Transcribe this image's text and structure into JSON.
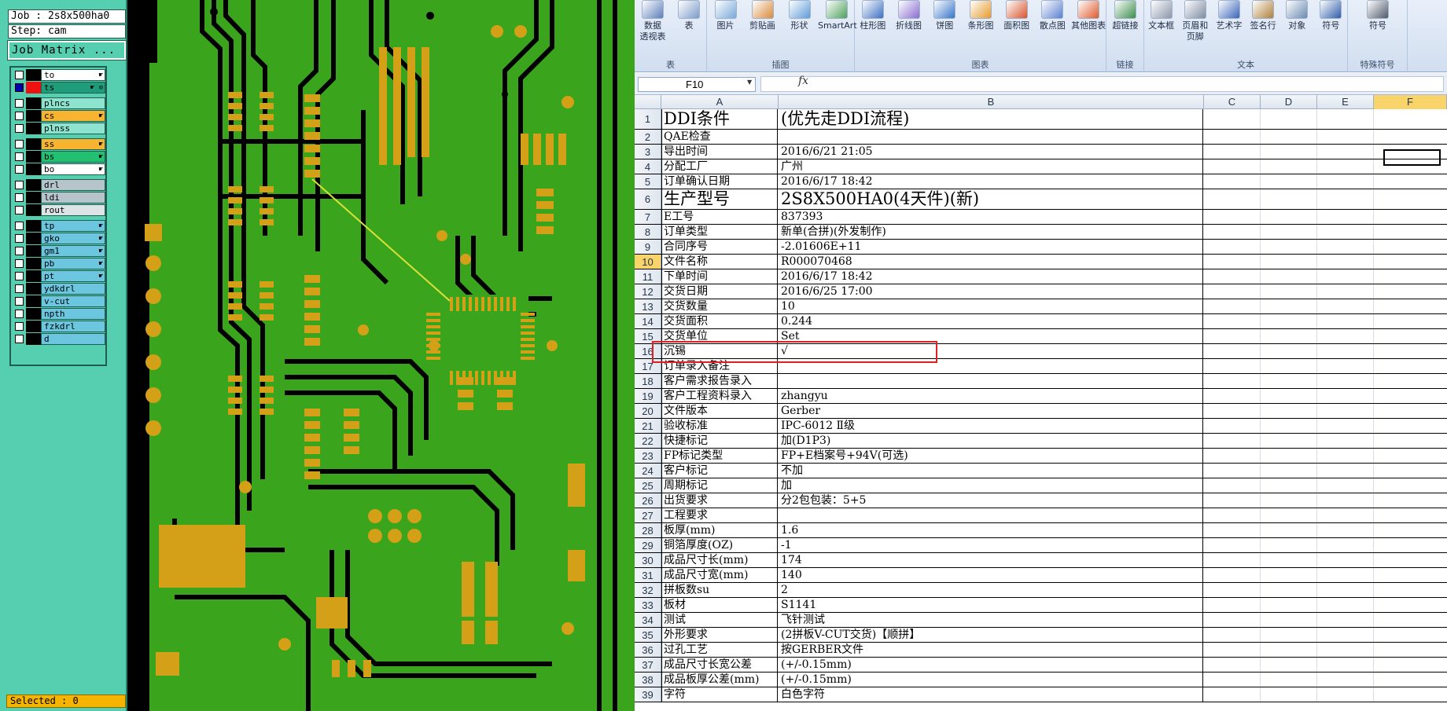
{
  "cam": {
    "job_label": "Job : 2s8x500ha0",
    "step_label": "Step: cam",
    "matrix_button": "Job Matrix ...",
    "selected_label": "Selected : 0",
    "layers": [
      {
        "name": "to",
        "color": "white",
        "mark": "☛"
      },
      {
        "name": "ts",
        "color": "teal",
        "mark": "☛ ⊙",
        "checked": true,
        "swatch": "red"
      },
      {
        "name": "plncs",
        "color": "cyan",
        "mark": ""
      },
      {
        "name": "cs",
        "color": "orange",
        "mark": "☛"
      },
      {
        "name": "plnss",
        "color": "cyan",
        "mark": ""
      },
      {
        "name": "ss",
        "color": "orange",
        "mark": "☛"
      },
      {
        "name": "bs",
        "color": "green",
        "mark": "☛"
      },
      {
        "name": "bo",
        "color": "white",
        "mark": "☛"
      },
      {
        "name": "drl",
        "color": "gray",
        "mark": ""
      },
      {
        "name": "ldi",
        "color": "gray",
        "mark": ""
      },
      {
        "name": "rout",
        "color": "ltgray",
        "mark": ""
      },
      {
        "name": "tp",
        "color": "blue",
        "mark": "☛"
      },
      {
        "name": "gko",
        "color": "blue",
        "mark": "☛"
      },
      {
        "name": "gm1",
        "color": "blue",
        "mark": "☛"
      },
      {
        "name": "pb",
        "color": "blue",
        "mark": "☛"
      },
      {
        "name": "pt",
        "color": "blue",
        "mark": "☛"
      },
      {
        "name": "ydkdrl",
        "color": "blue",
        "mark": ""
      },
      {
        "name": "v-cut",
        "color": "blue",
        "mark": ""
      },
      {
        "name": "npth",
        "color": "blue",
        "mark": ""
      },
      {
        "name": "fzkdrl",
        "color": "blue",
        "mark": ""
      },
      {
        "name": "d",
        "color": "blue",
        "mark": ""
      }
    ]
  },
  "excel": {
    "ribbon": {
      "groups": [
        {
          "title": "表",
          "buttons": [
            {
              "label": "数据\n透视表",
              "icon": "pivot-table-icon"
            },
            {
              "label": "表",
              "icon": "table-icon"
            }
          ]
        },
        {
          "title": "插图",
          "buttons": [
            {
              "label": "图片",
              "icon": "picture-icon"
            },
            {
              "label": "剪贴画",
              "icon": "clipart-icon"
            },
            {
              "label": "形状",
              "icon": "shapes-icon"
            },
            {
              "label": "SmartArt",
              "icon": "smartart-icon"
            }
          ]
        },
        {
          "title": "图表",
          "buttons": [
            {
              "label": "柱形图",
              "icon": "column-chart-icon"
            },
            {
              "label": "折线图",
              "icon": "line-chart-icon"
            },
            {
              "label": "饼图",
              "icon": "pie-chart-icon"
            },
            {
              "label": "条形图",
              "icon": "bar-chart-icon"
            },
            {
              "label": "面积图",
              "icon": "area-chart-icon"
            },
            {
              "label": "散点图",
              "icon": "scatter-chart-icon"
            },
            {
              "label": "其他图表",
              "icon": "other-chart-icon"
            }
          ]
        },
        {
          "title": "链接",
          "buttons": [
            {
              "label": "超链接",
              "icon": "hyperlink-icon"
            }
          ]
        },
        {
          "title": "文本",
          "buttons": [
            {
              "label": "文本框",
              "icon": "textbox-icon"
            },
            {
              "label": "页眉和\n页脚",
              "icon": "header-footer-icon"
            },
            {
              "label": "艺术字",
              "icon": "wordart-icon"
            },
            {
              "label": "签名行",
              "icon": "signature-icon"
            },
            {
              "label": "对象",
              "icon": "object-icon"
            },
            {
              "label": "符号",
              "icon": "symbol-icon"
            }
          ]
        },
        {
          "title": "特殊符号",
          "buttons": [
            {
              "label": "符号",
              "icon": "special-symbol-icon"
            }
          ]
        }
      ]
    },
    "namebox": "F10",
    "fx": "fx",
    "formula": "",
    "columns": [
      "A",
      "B",
      "C",
      "D",
      "E",
      "F"
    ],
    "active_column": "F",
    "rows": [
      {
        "n": "1",
        "a": "DDI条件",
        "b": "(优先走DDI流程)",
        "big": true
      },
      {
        "n": "2",
        "a": "QAE检查",
        "b": ""
      },
      {
        "n": "3",
        "a": "导出时间",
        "b": "2016/6/21 21:05"
      },
      {
        "n": "4",
        "a": "分配工厂",
        "b": "广州"
      },
      {
        "n": "5",
        "a": "订单确认日期",
        "b": "2016/6/17 18:42"
      },
      {
        "n": "6",
        "a": "生产型号",
        "b": "2S8X500HA0(4天件)(新)",
        "big": true
      },
      {
        "n": "7",
        "a": "E工号",
        "b": "837393"
      },
      {
        "n": "8",
        "a": "订单类型",
        "b": "新单(合拼)(外发制作)"
      },
      {
        "n": "9",
        "a": "合同序号",
        "b": "-2.01606E+11"
      },
      {
        "n": "10",
        "a": "文件名称",
        "b": "R000070468"
      },
      {
        "n": "11",
        "a": "下单时间",
        "b": "2016/6/17 18:42"
      },
      {
        "n": "12",
        "a": "交货日期",
        "b": "2016/6/25 17:00"
      },
      {
        "n": "13",
        "a": "交货数量",
        "b": "10"
      },
      {
        "n": "14",
        "a": "交货面积",
        "b": "0.244"
      },
      {
        "n": "15",
        "a": "交货单位",
        "b": "Set"
      },
      {
        "n": "16",
        "a": "沉锡",
        "b": "√"
      },
      {
        "n": "17",
        "a": "订单录入备注",
        "b": ""
      },
      {
        "n": "18",
        "a": "客户需求报告录入",
        "b": ""
      },
      {
        "n": "19",
        "a": "客户工程资料录入",
        "b": "zhangyu"
      },
      {
        "n": "20",
        "a": "文件版本",
        "b": "Gerber"
      },
      {
        "n": "21",
        "a": "验收标准",
        "b": "IPC-6012 Ⅱ级"
      },
      {
        "n": "22",
        "a": "快捷标记",
        "b": "加(D1P3)"
      },
      {
        "n": "23",
        "a": "FP标记类型",
        "b": "FP+E档案号+94V(可选)"
      },
      {
        "n": "24",
        "a": "客户标记",
        "b": "不加"
      },
      {
        "n": "25",
        "a": "周期标记",
        "b": "加"
      },
      {
        "n": "26",
        "a": "出货要求",
        "b": "分2包包装：5+5"
      },
      {
        "n": "27",
        "a": "工程要求",
        "b": ""
      },
      {
        "n": "28",
        "a": "板厚(mm)",
        "b": "1.6"
      },
      {
        "n": "29",
        "a": "铜箔厚度(OZ)",
        "b": "-1"
      },
      {
        "n": "30",
        "a": "成品尺寸长(mm)",
        "b": "174"
      },
      {
        "n": "31",
        "a": "成品尺寸宽(mm)",
        "b": "140"
      },
      {
        "n": "32",
        "a": "拼板数su",
        "b": "2"
      },
      {
        "n": "33",
        "a": "板材",
        "b": "S1141"
      },
      {
        "n": "34",
        "a": "测试",
        "b": "飞针测试"
      },
      {
        "n": "35",
        "a": "外形要求",
        "b": "(2拼板V-CUT交货)【顺拼】"
      },
      {
        "n": "36",
        "a": "过孔工艺",
        "b": "按GERBER文件"
      },
      {
        "n": "37",
        "a": "成品尺寸长宽公差",
        "b": "(+/-0.15mm)"
      },
      {
        "n": "38",
        "a": "成品板厚公差(mm)",
        "b": "(+/-0.15mm)"
      },
      {
        "n": "39",
        "a": "字符",
        "b": "白色字符"
      }
    ]
  },
  "colors": {
    "cam_bg": "#56cfb0",
    "pcb_copper": "#d4a017",
    "pcb_mask": "#3aa51c",
    "excel_ribbon": "#dbe5f3",
    "highlight_box": "#e02020"
  }
}
